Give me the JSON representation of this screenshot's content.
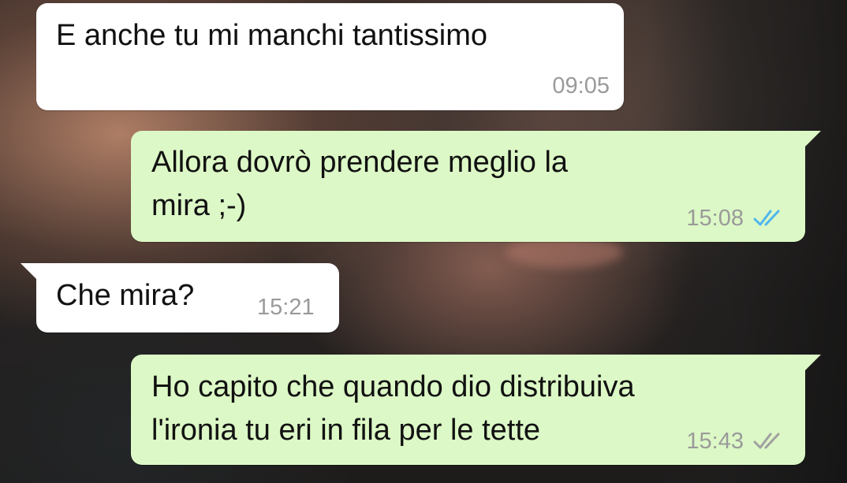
{
  "conversation": {
    "messages": [
      {
        "direction": "incoming",
        "text": "E anche tu mi manchi tantissimo",
        "time": "09:05"
      },
      {
        "direction": "outgoing",
        "text": "Allora dovrò prendere meglio la\nmira ;-)",
        "time": "15:08",
        "status": "read"
      },
      {
        "direction": "incoming",
        "text": "Che mira?",
        "time": "15:21"
      },
      {
        "direction": "outgoing",
        "text": "Ho capito che quando dio distribuiva\nl'ironia tu eri in fila per le tette",
        "time": "15:43",
        "status": "delivered"
      }
    ]
  },
  "colors": {
    "incoming_bubble": "#ffffff",
    "outgoing_bubble": "#dcf8c6",
    "timestamp": "#9a9a9a",
    "read_ticks": "#4fb6ec",
    "delivered_ticks": "#a0a0a0"
  },
  "icons": {
    "read_status": "double-check-blue-icon",
    "delivered_status": "double-check-gray-icon"
  }
}
